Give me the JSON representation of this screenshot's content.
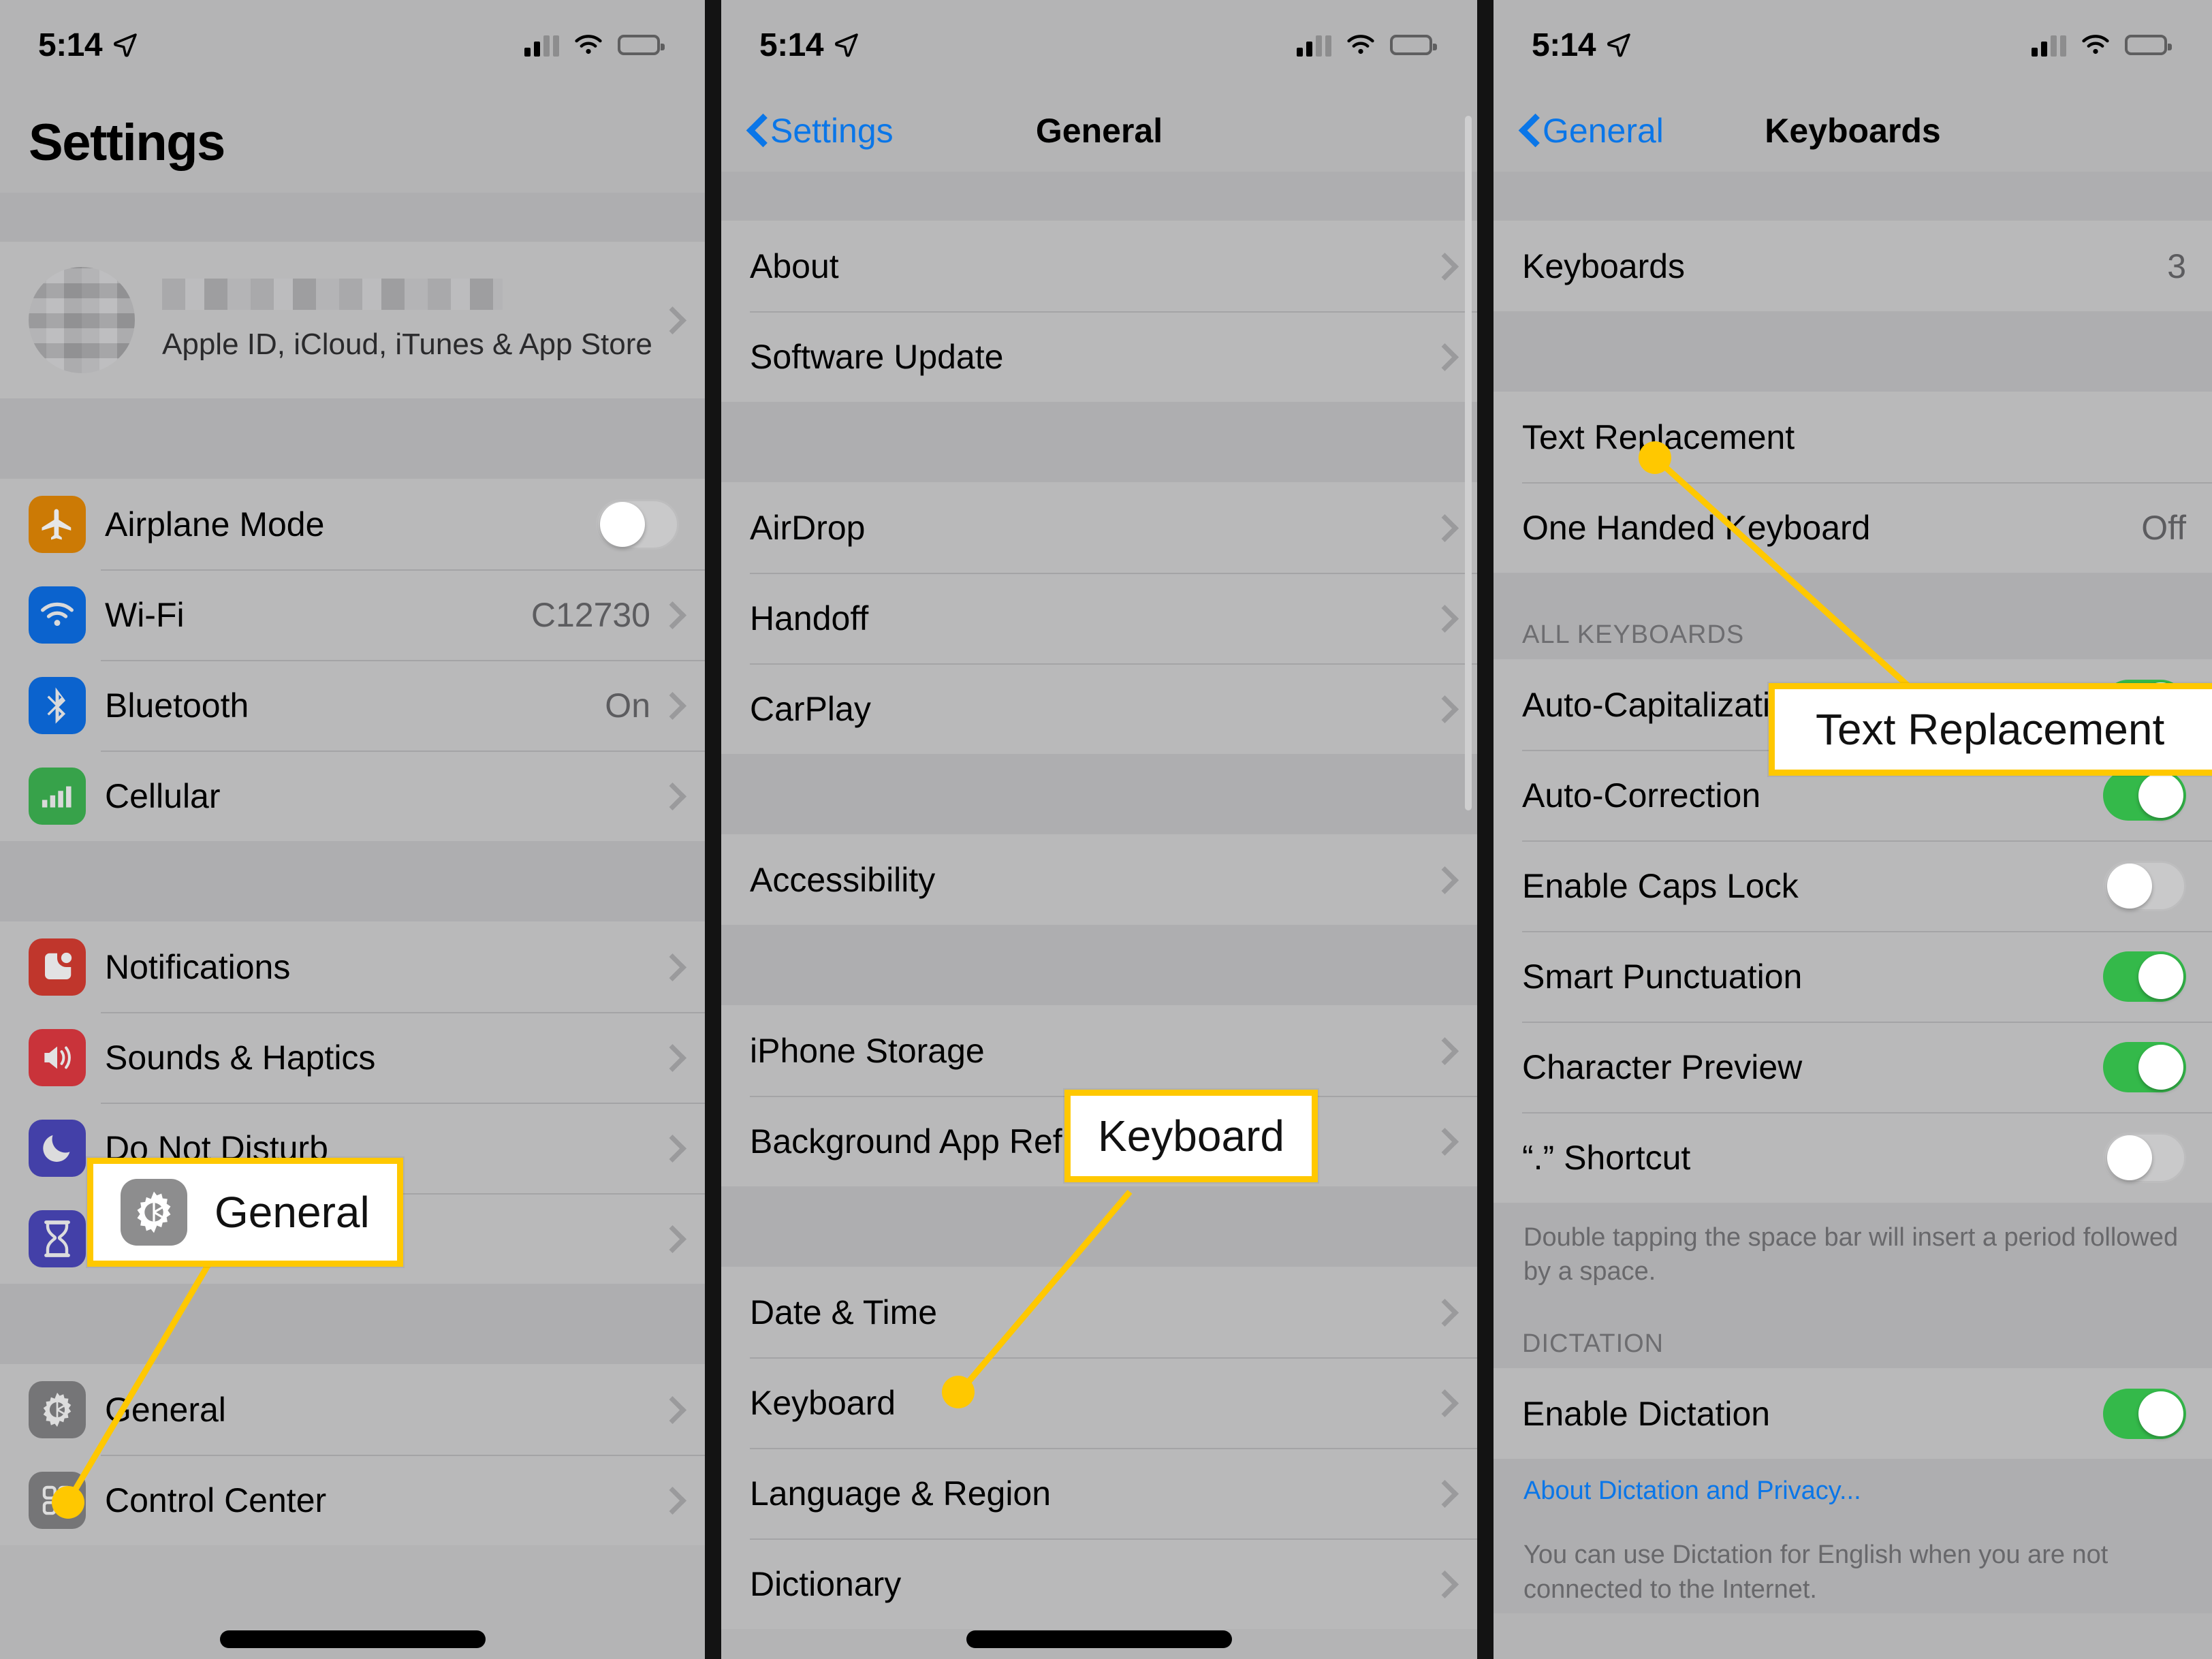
{
  "status_bar": {
    "time": "5:14",
    "location_icon": "location-arrow-icon",
    "signal_icon": "cellular-signal-icon",
    "wifi_icon": "wifi-icon",
    "battery_icon": "battery-icon"
  },
  "colors": {
    "annotation": "#FFC800",
    "link_blue": "#0A76E8",
    "toggle_on_green": "#34B94A",
    "list_bg": "#B9B9BA",
    "group_bg": "#AEAEB0"
  },
  "left_panel": {
    "title": "Settings",
    "apple_id": {
      "subtitle": "Apple ID, iCloud, iTunes & App Store",
      "avatar": "redacted-avatar",
      "name": "redacted-name"
    },
    "group1": [
      {
        "label": "Airplane Mode",
        "icon": "airplane-icon",
        "icon_color": "#CC7A05",
        "control": "toggle",
        "state": "off"
      },
      {
        "label": "Wi-Fi",
        "icon": "wifi-icon",
        "icon_color": "#0B63CE",
        "value": "C12730",
        "control": "chevron"
      },
      {
        "label": "Bluetooth",
        "icon": "bluetooth-icon",
        "icon_color": "#0B63CE",
        "value": "On",
        "control": "chevron"
      },
      {
        "label": "Cellular",
        "icon": "cellular-icon",
        "icon_color": "#37A24A",
        "value": "",
        "control": "chevron"
      }
    ],
    "group2": [
      {
        "label": "Notifications",
        "icon": "notifications-icon",
        "icon_color": "#C0362C",
        "control": "chevron"
      },
      {
        "label": "Sounds & Haptics",
        "icon": "sounds-icon",
        "icon_color": "#C9333A",
        "control": "chevron"
      },
      {
        "label": "Do Not Disturb",
        "icon": "do-not-disturb-icon",
        "icon_color": "#4340A8",
        "control": "chevron"
      },
      {
        "label": "Screen Time",
        "icon": "screen-time-icon",
        "icon_color": "#4340A8",
        "control": "chevron"
      }
    ],
    "group3": [
      {
        "label": "General",
        "icon": "gear-icon",
        "icon_color": "#757577",
        "control": "chevron"
      },
      {
        "label": "Control Center",
        "icon": "control-center-icon",
        "icon_color": "#757577",
        "control": "chevron"
      }
    ]
  },
  "mid_panel": {
    "back_label": "Settings",
    "title": "General",
    "group1": [
      {
        "label": "About"
      },
      {
        "label": "Software Update"
      }
    ],
    "group2": [
      {
        "label": "AirDrop"
      },
      {
        "label": "Handoff"
      },
      {
        "label": "CarPlay"
      }
    ],
    "group3": [
      {
        "label": "Accessibility"
      }
    ],
    "group4": [
      {
        "label": "iPhone Storage"
      },
      {
        "label": "Background App Refresh"
      }
    ],
    "group5": [
      {
        "label": "Date & Time"
      },
      {
        "label": "Keyboard"
      },
      {
        "label": "Language & Region"
      },
      {
        "label": "Dictionary"
      }
    ]
  },
  "right_panel": {
    "back_label": "General",
    "title": "Keyboards",
    "group1": [
      {
        "label": "Keyboards",
        "value": "3"
      }
    ],
    "group2": [
      {
        "label": "Text Replacement",
        "value": ""
      },
      {
        "label": "One Handed Keyboard",
        "value": "Off"
      }
    ],
    "all_keyboards_header": "ALL KEYBOARDS",
    "all_keyboards": [
      {
        "label": "Auto-Capitalization",
        "toggle": "on"
      },
      {
        "label": "Auto-Correction",
        "toggle": "on"
      },
      {
        "label": "Enable Caps Lock",
        "toggle": "off"
      },
      {
        "label": "Smart Punctuation",
        "toggle": "on"
      },
      {
        "label": "Character Preview",
        "toggle": "on"
      },
      {
        "label": "“.” Shortcut",
        "toggle": "off"
      }
    ],
    "shortcut_footnote": "Double tapping the space bar will insert a period followed by a space.",
    "dictation_header": "DICTATION",
    "dictation": [
      {
        "label": "Enable Dictation",
        "toggle": "on"
      }
    ],
    "dictation_link": "About Dictation and Privacy...",
    "dictation_footnote": "You can use Dictation for English when you are not connected to the Internet."
  },
  "annotations": [
    {
      "label": "General",
      "icon": "gear-icon",
      "target": "general-row-left-panel"
    },
    {
      "label": "Keyboard",
      "target": "keyboard-row-mid-panel"
    },
    {
      "label": "Text Replacement",
      "target": "text-replacement-row-right-panel"
    }
  ]
}
